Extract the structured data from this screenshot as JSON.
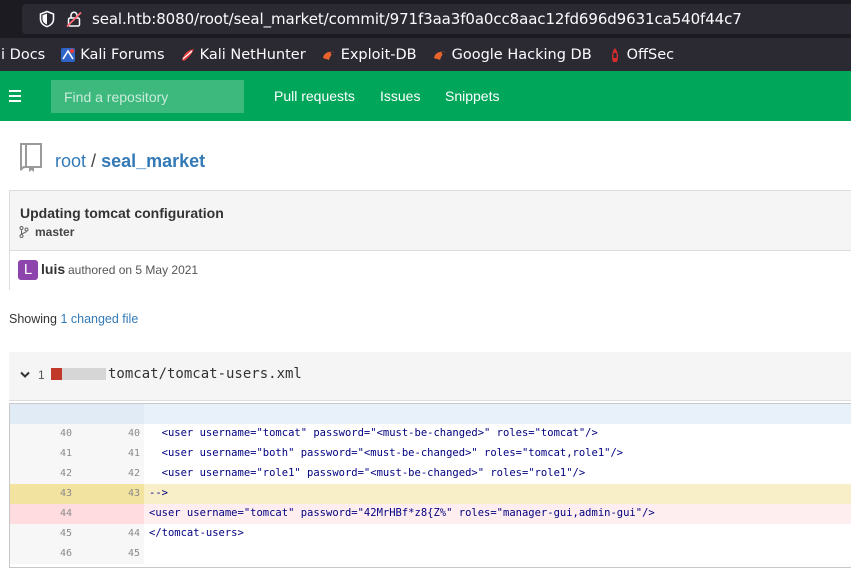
{
  "browser": {
    "url": "seal.htb:8080/root/seal_market/commit/971f3aa3f0a0cc8aac12fd696d9631ca540f44c7",
    "bookmarks": [
      "li Docs",
      "Kali Forums",
      "Kali NetHunter",
      "Exploit-DB",
      "Google Hacking DB",
      "OffSec"
    ]
  },
  "header": {
    "search_placeholder": "Find a repository",
    "nav": [
      "Pull requests",
      "Issues",
      "Snippets"
    ]
  },
  "repo": {
    "owner": "root",
    "separator": "/",
    "name": "seal_market"
  },
  "commit": {
    "message": "Updating tomcat configuration",
    "branch": "master",
    "avatar_letter": "L",
    "author": "luis",
    "authored_text": "authored on 5 May 2021"
  },
  "showing": {
    "prefix": "Showing",
    "link": "1 changed file"
  },
  "file": {
    "count": "1",
    "path": "tomcat/tomcat-users.xml"
  },
  "diff_lines": [
    {
      "type": "ctx",
      "old": "40",
      "new": "40",
      "code": "  <user username=\"tomcat\" password=\"<must-be-changed>\" roles=\"tomcat\"/>"
    },
    {
      "type": "ctx",
      "old": "41",
      "new": "41",
      "code": "  <user username=\"both\" password=\"<must-be-changed>\" roles=\"tomcat,role1\"/>"
    },
    {
      "type": "ctx",
      "old": "42",
      "new": "42",
      "code": "  <user username=\"role1\" password=\"<must-be-changed>\" roles=\"role1\"/>"
    },
    {
      "type": "hl",
      "old": "43",
      "new": "43",
      "code": "-->"
    },
    {
      "type": "del",
      "old": "44",
      "new": "",
      "code": "<user username=\"tomcat\" password=\"42MrHBf*z8{Z%\" roles=\"manager-gui,admin-gui\"/>"
    },
    {
      "type": "ctx",
      "old": "45",
      "new": "44",
      "code": "</tomcat-users>"
    },
    {
      "type": "ctx",
      "old": "46",
      "new": "45",
      "code": ""
    }
  ],
  "colors": {
    "header_green": "#00a65a",
    "link_blue": "#337ab7",
    "avatar_purple": "#8e44ad",
    "deleted_bar": "#c0392b"
  }
}
